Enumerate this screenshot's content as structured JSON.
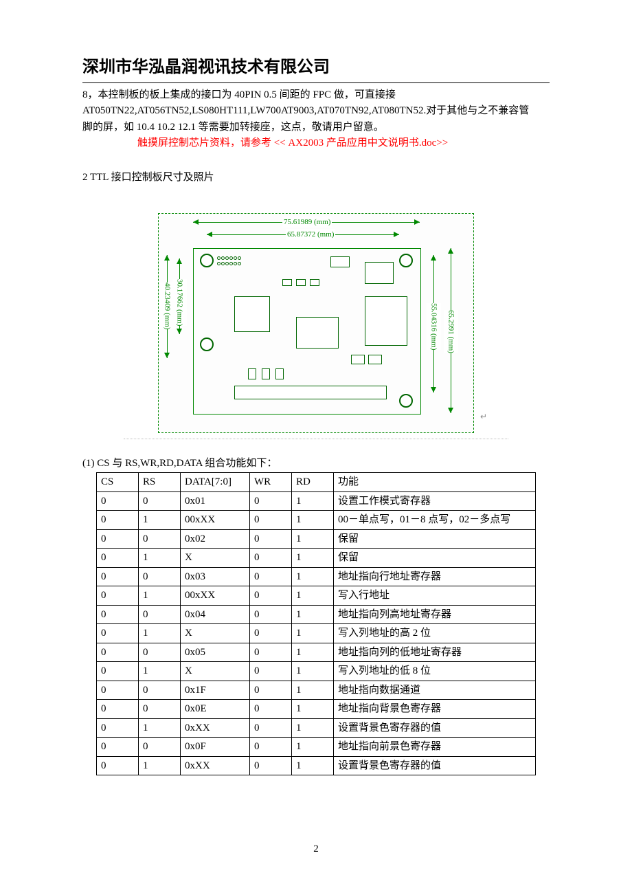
{
  "header": {
    "company": "深圳市华泓晶润视讯技术有限公司"
  },
  "intro": {
    "lead": "8，本控制板的板上集成的接口为 40PIN 0.5 间距的 FPC 做，可直接接",
    "line2": "AT050TN22,AT056TN52,LS080HT111,LW700AT9003,AT070TN92,AT080TN52.对于其他与之不兼容管",
    "line3": "脚的屏，如 10.4 10.2 12.1 等需要加转接座，这点，敬请用户留意。",
    "ref_note": "触摸屏控制芯片资料，请参考 << AX2003 产品应用中文说明书.doc>>"
  },
  "section2_title": "2   TTL 接口控制板尺寸及照片",
  "dims": {
    "top_outer": "75.61989 (mm)",
    "top_inner": "65.87372 (mm)",
    "left_outer": "40.23409 (mm)",
    "left_inner": "30.17662 (mm)",
    "right_inner": "55.04316 (mm)",
    "right_outer": "65.2991 (mm)"
  },
  "table_caption": "(1) CS 与 RS,WR,RD,DATA 组合功能如下：",
  "table_headers": {
    "cs": "CS",
    "rs": "RS",
    "data": "DATA[7:0]",
    "wr": "WR",
    "rd": "RD",
    "func": "功能"
  },
  "table_rows": [
    {
      "cs": "0",
      "rs": "0",
      "data": "0x01",
      "wr": "0",
      "rd": "1",
      "func": "设置工作模式寄存器"
    },
    {
      "cs": "0",
      "rs": "1",
      "data": "00xXX",
      "wr": "0",
      "rd": "1",
      "func": "00－单点写，01－8 点写，02－多点写"
    },
    {
      "cs": "0",
      "rs": "0",
      "data": "0x02",
      "wr": "0",
      "rd": "1",
      "func": "保留"
    },
    {
      "cs": "0",
      "rs": "1",
      "data": "X",
      "wr": "0",
      "rd": "1",
      "func": "保留"
    },
    {
      "cs": "0",
      "rs": "0",
      "data": "0x03",
      "wr": "0",
      "rd": "1",
      "func": "地址指向行地址寄存器"
    },
    {
      "cs": "0",
      "rs": "1",
      "data": "00xXX",
      "wr": "0",
      "rd": "1",
      "func": "写入行地址"
    },
    {
      "cs": "0",
      "rs": "0",
      "data": "0x04",
      "wr": "0",
      "rd": "1",
      "func": "地址指向列高地址寄存器"
    },
    {
      "cs": "0",
      "rs": "1",
      "data": "X",
      "wr": "0",
      "rd": "1",
      "func": "写入列地址的高 2 位"
    },
    {
      "cs": "0",
      "rs": "0",
      "data": "0x05",
      "wr": "0",
      "rd": "1",
      "func": "地址指向列的低地址寄存器"
    },
    {
      "cs": "0",
      "rs": "1",
      "data": "X",
      "wr": "0",
      "rd": "1",
      "func": "写入列地址的低 8 位"
    },
    {
      "cs": "0",
      "rs": "0",
      "data": "0x1F",
      "wr": "0",
      "rd": "1",
      "func": "地址指向数据通道"
    },
    {
      "cs": "0",
      "rs": "0",
      "data": "0x0E",
      "wr": "0",
      "rd": "1",
      "func": "地址指向背景色寄存器"
    },
    {
      "cs": "0",
      "rs": "1",
      "data": "0xXX",
      "wr": "0",
      "rd": "1",
      "func": "设置背景色寄存器的值"
    },
    {
      "cs": "0",
      "rs": "0",
      "data": "0x0F",
      "wr": "0",
      "rd": "1",
      "func": "地址指向前景色寄存器"
    },
    {
      "cs": "0",
      "rs": "1",
      "data": "0xXX",
      "wr": "0",
      "rd": "1",
      "func": "设置背景色寄存器的值"
    }
  ],
  "footer": {
    "page_number": "2"
  }
}
